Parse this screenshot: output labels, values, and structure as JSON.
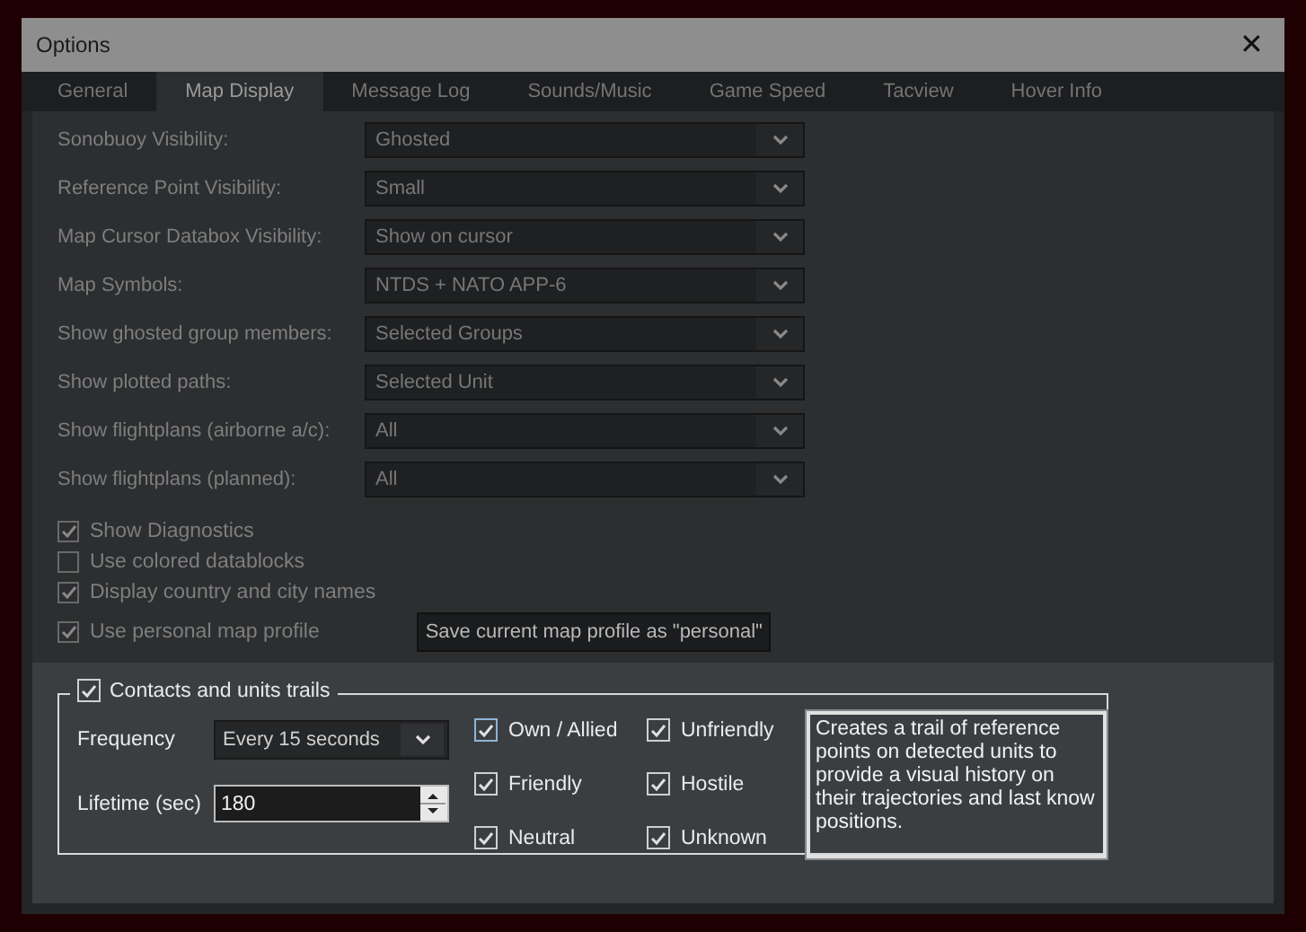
{
  "window": {
    "title": "Options",
    "close": "✕"
  },
  "tabs": [
    {
      "label": "General",
      "selected": false
    },
    {
      "label": "Map Display",
      "selected": true
    },
    {
      "label": "Message Log",
      "selected": false
    },
    {
      "label": "Sounds/Music",
      "selected": false
    },
    {
      "label": "Game Speed",
      "selected": false
    },
    {
      "label": "Tacview",
      "selected": false
    },
    {
      "label": "Hover Info",
      "selected": false
    }
  ],
  "settings": [
    {
      "label": "Sonobuoy Visibility:",
      "value": "Ghosted"
    },
    {
      "label": "Reference Point Visibility:",
      "value": "Small"
    },
    {
      "label": "Map Cursor Databox Visibility:",
      "value": "Show on cursor"
    },
    {
      "label": "Map Symbols:",
      "value": "NTDS + NATO APP-6"
    },
    {
      "label": "Show ghosted group members:",
      "value": "Selected Groups"
    },
    {
      "label": "Show plotted paths:",
      "value": "Selected Unit"
    },
    {
      "label": "Show flightplans (airborne a/c):",
      "value": "All"
    },
    {
      "label": "Show flightplans (planned):",
      "value": "All"
    }
  ],
  "options": [
    {
      "label": "Show Diagnostics",
      "checked": true
    },
    {
      "label": "Use colored datablocks",
      "checked": false
    },
    {
      "label": "Display country and city names",
      "checked": true
    },
    {
      "label": "Use personal map profile",
      "checked": true
    }
  ],
  "save_profile_button": "Save current map profile as \"personal\"",
  "trails": {
    "label": "Contacts and units trails",
    "checked": true,
    "frequency": {
      "label": "Frequency",
      "value": "Every 15 seconds"
    },
    "lifetime": {
      "label": "Lifetime (sec)",
      "value": "180"
    },
    "sides": [
      {
        "label": "Own / Allied",
        "checked": true
      },
      {
        "label": "Unfriendly",
        "checked": true
      },
      {
        "label": "Friendly",
        "checked": true
      },
      {
        "label": "Hostile",
        "checked": true
      },
      {
        "label": "Neutral",
        "checked": true
      },
      {
        "label": "Unknown",
        "checked": true
      }
    ],
    "description": "Creates a trail of reference points on detected units to provide a visual history on their trajectories and last know positions."
  }
}
